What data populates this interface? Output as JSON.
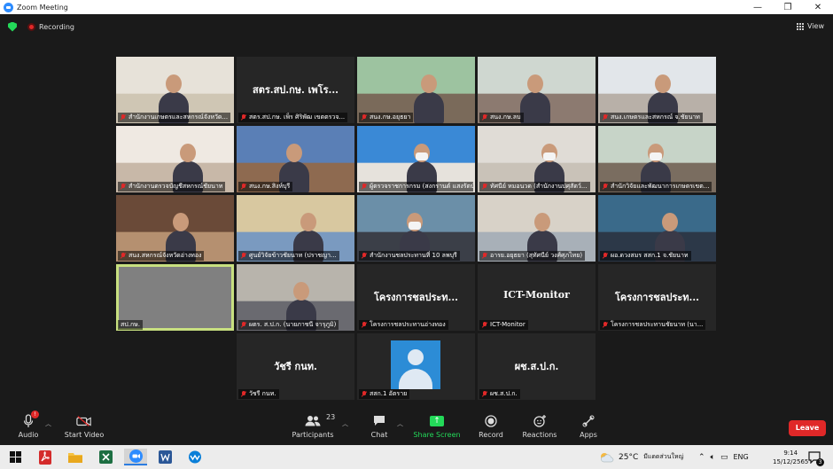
{
  "window": {
    "title": "Zoom Meeting",
    "minimize_glyph": "—",
    "maximize_glyph": "❐",
    "close_glyph": "✕"
  },
  "status": {
    "recording_label": "Recording",
    "view_label": "View"
  },
  "tiles": [
    {
      "name": "สำนักงานเกษตรและสหกรณ์จังหวัด...",
      "big": "",
      "colors": [
        "#e7e2d9",
        "#cfc6b4"
      ]
    },
    {
      "name": "สตร.สป.กษ. เพ็ร ศิริพัฒ เขตตรวจ...",
      "big": "สตร.สป.กษ. เพโร...",
      "colors": [
        "#262626",
        "#262626"
      ]
    },
    {
      "name": "สนง.กษ.อยุธยา",
      "big": "",
      "colors": [
        "#9dc3a0",
        "#7a6a5a"
      ]
    },
    {
      "name": "สนง.กษ.ลบ",
      "big": "",
      "colors": [
        "#cfd7d0",
        "#8c7a70"
      ]
    },
    {
      "name": "สนง.เกษตรและสหกรณ์ จ.ชัยนาท",
      "big": "",
      "colors": [
        "#e2e6ea",
        "#b8b0a8"
      ]
    },
    {
      "name": "สำนักงานตรวจบัญชีสหกรณ์ชัยนาท",
      "big": "",
      "colors": [
        "#efe9e2",
        "#c8b8a8"
      ]
    },
    {
      "name": "สนง.กษ.สิงห์บุรี",
      "big": "",
      "colors": [
        "#5a7fb6",
        "#8e6a50"
      ]
    },
    {
      "name": "ผู้ตรวจราชการกรม (สงกรานต์ แสงรัตน์)",
      "big": "",
      "colors": [
        "#3a89d6",
        "#e6e2dc"
      ]
    },
    {
      "name": "ทัศนีย์ หมอนวด (สำนักงานปศุสัตว์...",
      "big": "",
      "colors": [
        "#e0dcd6",
        "#c9c2b8"
      ]
    },
    {
      "name": "สำนักวิจัยและพัฒนาการเกษตรเขต...",
      "big": "",
      "colors": [
        "#c7d4c8",
        "#7a6d60"
      ]
    },
    {
      "name": "สนง.สหกรณ์จังหวัดอ่างทอง",
      "big": "",
      "colors": [
        "#6a4a38",
        "#b59070"
      ]
    },
    {
      "name": "ศูนย์วิจัยข้าวชัยนาท (ปราชญา...",
      "big": "",
      "colors": [
        "#d8c8a0",
        "#7a9ac0"
      ]
    },
    {
      "name": "สำนักงานชลประทานที่ 10 ลพบุรี",
      "big": "",
      "colors": [
        "#6b8fa8",
        "#3b3f48"
      ]
    },
    {
      "name": "อารย.อยุธยา (สุทัศนีย์ วงศ์ศุภไทย)",
      "big": "",
      "colors": [
        "#d8d2c8",
        "#a8b0b8"
      ]
    },
    {
      "name": "ผอ.ดวงสมร สสก.1 จ.ชัยนาท",
      "big": "",
      "colors": [
        "#3a6a8a",
        "#2c3848"
      ]
    },
    {
      "name": "สป.กษ.",
      "big": "",
      "colors": [
        "#808080",
        "#808080"
      ]
    },
    {
      "name": "ผตร. ส.ป.ก. (นายภาชนี จารุภูมิ)",
      "big": "",
      "colors": [
        "#b8b4ac",
        "#6a6a70"
      ]
    },
    {
      "name": "โครงการชลประทานอ่างทอง",
      "big": "โครงการชลประท...",
      "colors": [
        "#262626",
        "#262626"
      ]
    },
    {
      "name": "ICT-Monitor",
      "big": "ICT-Monitor",
      "colors": [
        "#262626",
        "#262626"
      ]
    },
    {
      "name": "โครงการชลประทานชัยนาท (นา...",
      "big": "โครงการชลประท...",
      "colors": [
        "#262626",
        "#262626"
      ]
    },
    {
      "name": "วัชรี กนท.",
      "big": "วัชรี กนท.",
      "colors": [
        "#262626",
        "#262626"
      ]
    },
    {
      "name": "สสก.1 อัตราย",
      "big": "",
      "colors": [
        "#262626",
        "#262626"
      ]
    },
    {
      "name": "ผช.ส.ป.ก.",
      "big": "ผช.ส.ป.ก.",
      "colors": [
        "#262626",
        "#262626"
      ]
    }
  ],
  "controls": {
    "audio": "Audio",
    "audio_badge": "!",
    "video": "Start Video",
    "participants": "Participants",
    "participants_count": "23",
    "chat": "Chat",
    "share": "Share Screen",
    "record": "Record",
    "reactions": "Reactions",
    "apps": "Apps",
    "leave": "Leave"
  },
  "taskbar": {
    "weather_temp": "25°C",
    "weather_text": "มีแดดส่วนใหญ่",
    "language": "ENG",
    "time": "9:14",
    "date": "15/12/2565",
    "notification_count": "3"
  },
  "colors": {
    "accent_blue": "#2d8cff",
    "recording_red": "#e02828",
    "share_green": "#23d959",
    "active_speaker": "#c8e080"
  }
}
